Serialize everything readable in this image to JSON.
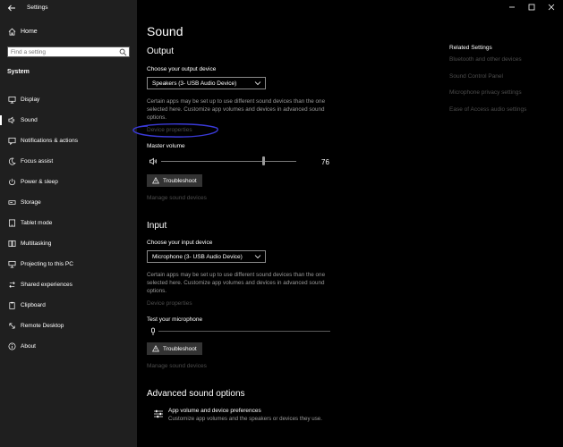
{
  "window": {
    "title": "Settings"
  },
  "sidebar": {
    "home_label": "Home",
    "search_placeholder": "Find a setting",
    "section_title": "System",
    "items": [
      {
        "label": "Display",
        "icon": "display-icon",
        "active": false
      },
      {
        "label": "Sound",
        "icon": "speaker-icon",
        "active": true
      },
      {
        "label": "Notifications & actions",
        "icon": "notification-icon",
        "active": false
      },
      {
        "label": "Focus assist",
        "icon": "moon-icon",
        "active": false
      },
      {
        "label": "Power & sleep",
        "icon": "power-icon",
        "active": false
      },
      {
        "label": "Storage",
        "icon": "storage-icon",
        "active": false
      },
      {
        "label": "Tablet mode",
        "icon": "tablet-icon",
        "active": false
      },
      {
        "label": "Multitasking",
        "icon": "multitasking-icon",
        "active": false
      },
      {
        "label": "Projecting to this PC",
        "icon": "projecting-icon",
        "active": false
      },
      {
        "label": "Shared experiences",
        "icon": "shared-icon",
        "active": false
      },
      {
        "label": "Clipboard",
        "icon": "clipboard-icon",
        "active": false
      },
      {
        "label": "Remote Desktop",
        "icon": "remote-desktop-icon",
        "active": false
      },
      {
        "label": "About",
        "icon": "info-icon",
        "active": false
      }
    ]
  },
  "main": {
    "title": "Sound",
    "output": {
      "heading": "Output",
      "device_label": "Choose your output device",
      "device_value": "Speakers (3- USB Audio Device)",
      "description": "Certain apps may be set up to use different sound devices than the one selected here. Customize app volumes and devices in advanced sound options.",
      "device_properties_link": "Device properties",
      "volume_label": "Master volume",
      "volume_value": "76",
      "volume_level": 76,
      "troubleshoot_label": "Troubleshoot",
      "manage_link": "Manage sound devices"
    },
    "input": {
      "heading": "Input",
      "device_label": "Choose your input device",
      "device_value": "Microphone (3- USB Audio Device)",
      "description": "Certain apps may be set up to use different sound devices than the one selected here. Customize app volumes and devices in advanced sound options.",
      "device_properties_link": "Device properties",
      "test_label": "Test your microphone",
      "mic_level": 0,
      "troubleshoot_label": "Troubleshoot",
      "manage_link": "Manage sound devices"
    },
    "advanced": {
      "heading": "Advanced sound options",
      "item_title": "App volume and device preferences",
      "item_desc": "Customize app volumes and the speakers or devices they use."
    },
    "related": {
      "heading": "Related Settings",
      "links": [
        "Bluetooth and other devices",
        "Sound Control Panel",
        "Microphone privacy settings",
        "Ease of Access audio settings"
      ]
    }
  },
  "colors": {
    "annotation_circle": "#3a3ad8",
    "disabled_link": "#4d4d4d"
  }
}
